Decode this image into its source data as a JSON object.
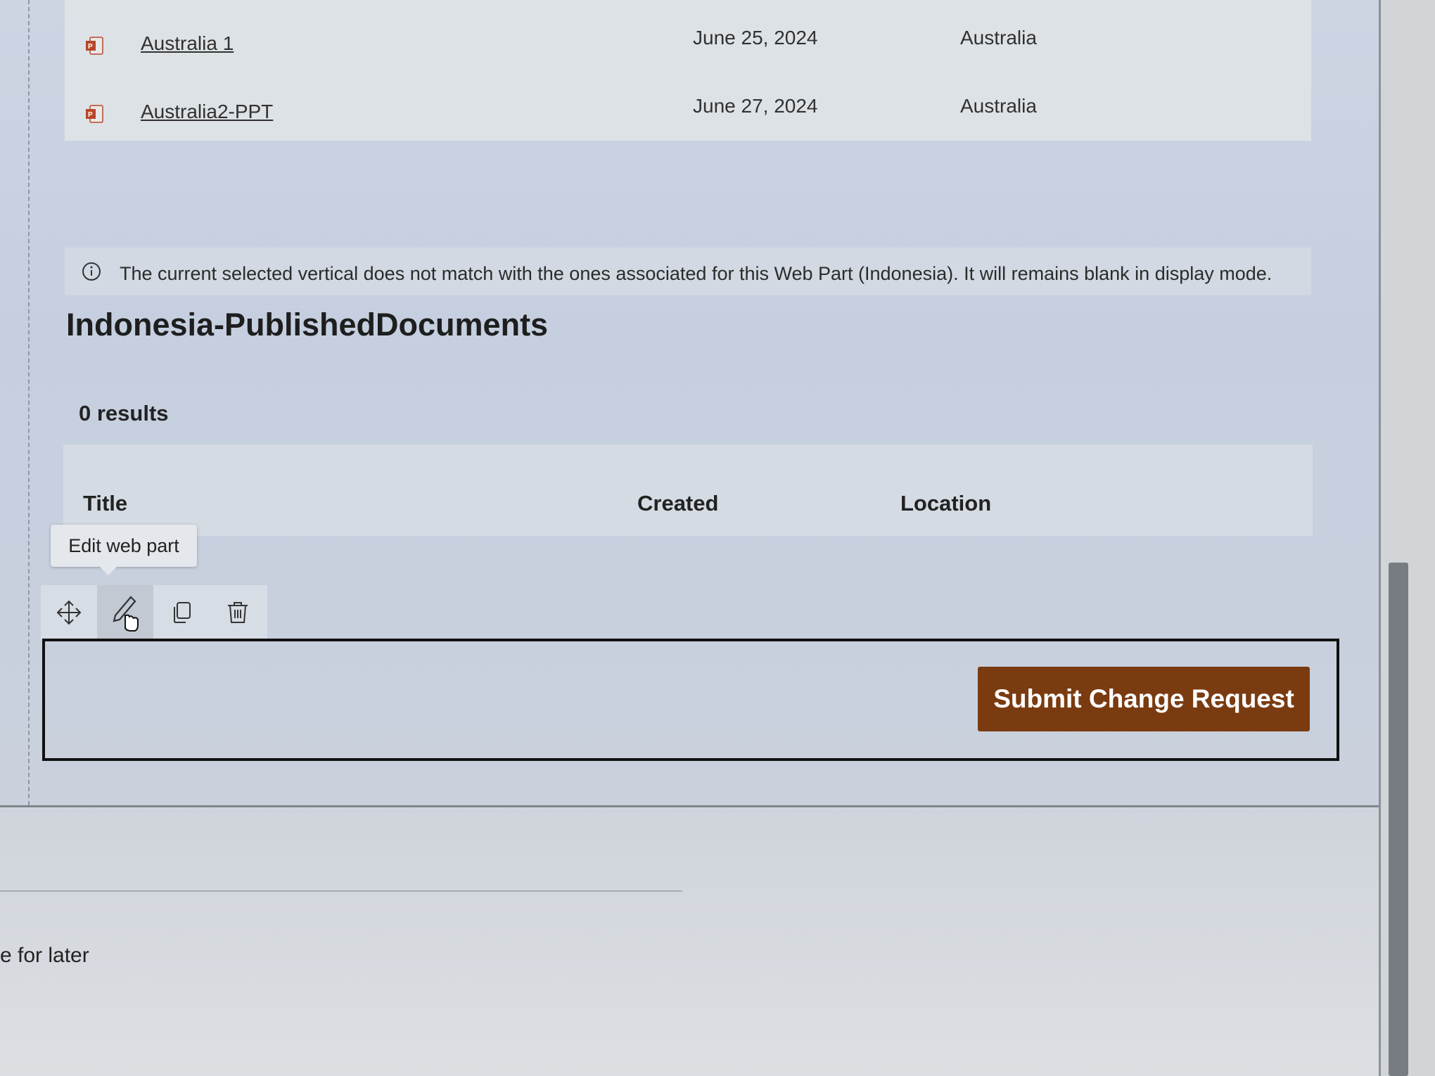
{
  "documents": {
    "rows": [
      {
        "title": "Australia 1",
        "created": "June 25, 2024",
        "location": "Australia",
        "icon": "powerpoint-file-icon"
      },
      {
        "title": "Australia2-PPT",
        "created": "June 27, 2024",
        "location": "Australia",
        "icon": "powerpoint-file-icon"
      }
    ]
  },
  "info_message": {
    "icon": "info-icon",
    "text": "The current selected vertical does not match with the ones associated for this Web Part (Indonesia). It will remains blank in display mode."
  },
  "webpart": {
    "title": "Indonesia-PublishedDocuments",
    "results_count": "0 results",
    "columns": [
      "Title",
      "Created",
      "Location"
    ]
  },
  "tooltip": {
    "text": "Edit web part"
  },
  "toolbar": {
    "tools": [
      "move-icon",
      "edit-pencil-icon",
      "duplicate-icon",
      "delete-trash-icon"
    ]
  },
  "button": {
    "label": "Submit Change Request",
    "color": "#7a3b10"
  },
  "footer": {
    "save_label": "e for later"
  }
}
